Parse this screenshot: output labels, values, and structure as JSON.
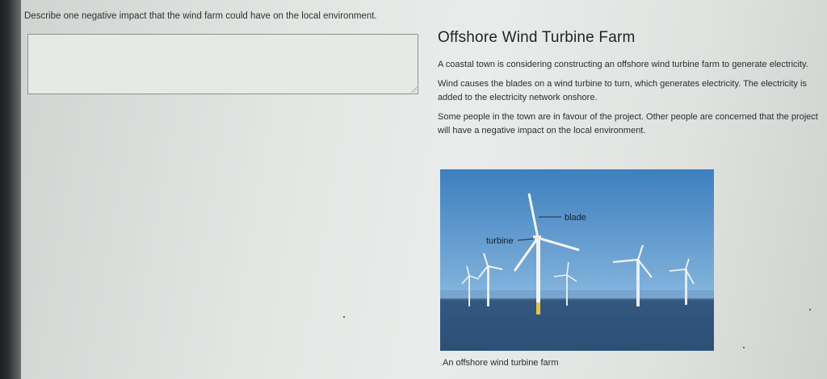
{
  "question": {
    "text": "Describe one negative impact that the wind farm could have on the local environment."
  },
  "answer_box": {
    "value": ""
  },
  "article": {
    "title": "Offshore Wind Turbine Farm",
    "paragraphs": [
      "A coastal town is considering constructing an offshore wind turbine farm to generate electricity.",
      "Wind causes the blades on a wind turbine to turn, which generates electricity. The electricity is added to the electricity network onshore.",
      "Some people in the town are in favour of the project. Other people are concerned that the project will have a negative impact on the local environment."
    ]
  },
  "figure": {
    "label_blade": "blade",
    "label_turbine": "turbine",
    "caption": "An offshore wind turbine farm",
    "colors": {
      "sky_top": "#3d7fbf",
      "sky_bottom": "#86b6dd",
      "sea": "#2c4f77",
      "tower": "#eef2f4"
    }
  }
}
